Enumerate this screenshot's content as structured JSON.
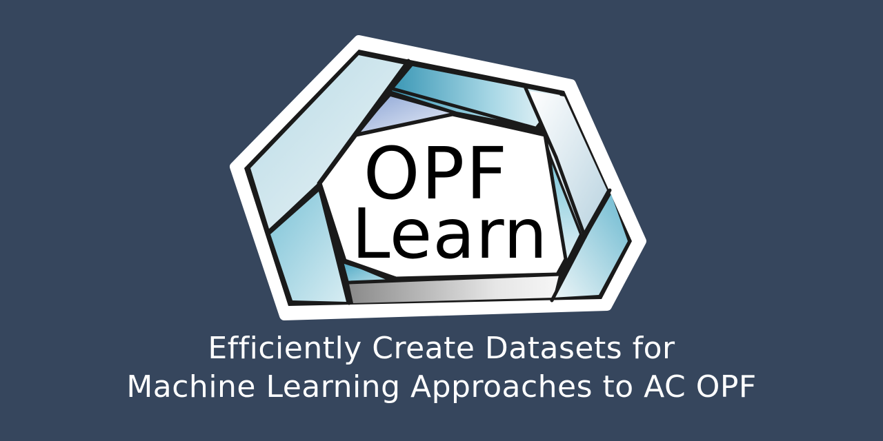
{
  "logo": {
    "line1": "OPF",
    "line2": "Learn"
  },
  "tagline": {
    "line1": "Efficiently Create Datasets for",
    "line2": "Machine Learning Approaches to AC OPF"
  },
  "colors": {
    "background": "#36465d",
    "text": "#ffffff",
    "outline": "#1a1a1a",
    "panel_light": "#dce9f0",
    "panel_mid": "#9fd0df",
    "panel_deep": "#5aaec8",
    "panel_gray": "#b8b8b8"
  }
}
